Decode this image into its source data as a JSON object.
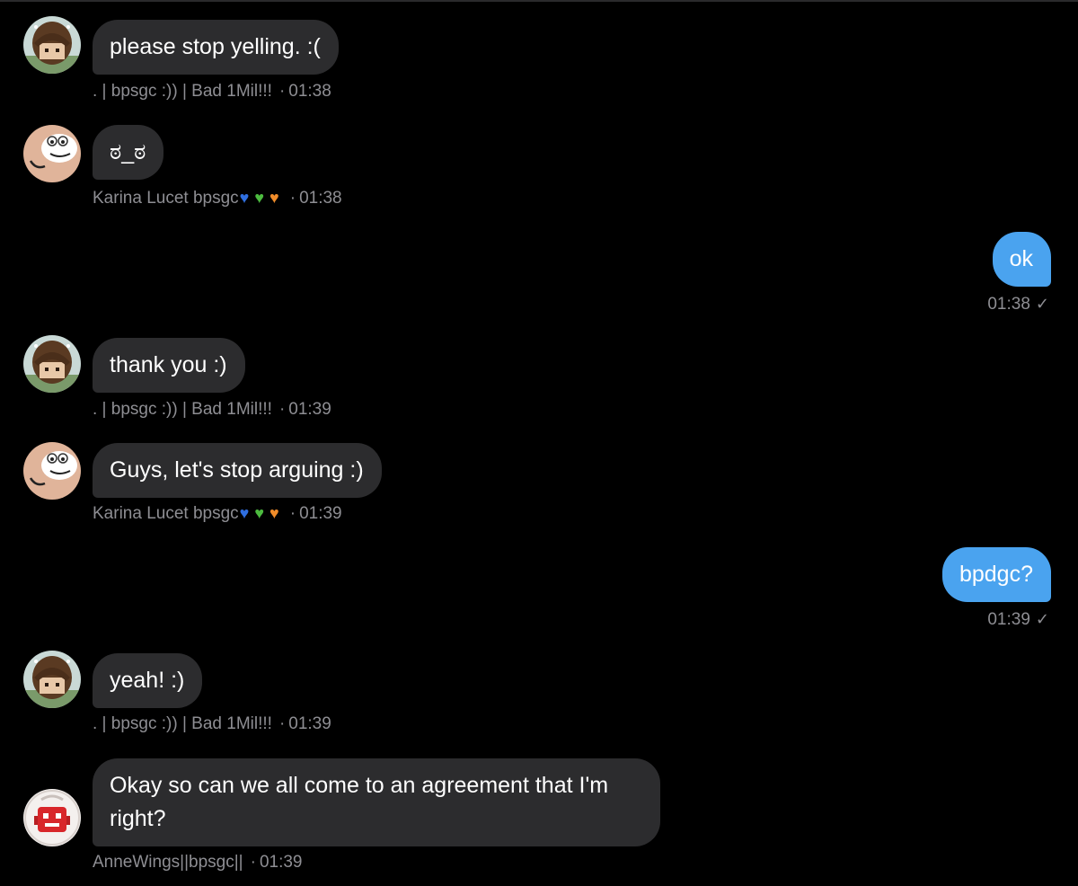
{
  "colors": {
    "background": "#000000",
    "incoming_bubble": "#2c2c2e",
    "outgoing_bubble": "#4aa3ef",
    "meta_text": "#8e8e93",
    "heart_blue": "#2f6fe0",
    "heart_green": "#4cbb3f",
    "heart_orange": "#f08c2a"
  },
  "messages": [
    {
      "text": "please stop yelling. :(",
      "sender": ". | bpsgc :)) | Bad 1Mil!!!",
      "time": "01:38",
      "avatar_icon": "brown-hair-character-icon"
    },
    {
      "text": "ಠ_ಠ",
      "sender": "Karina Lucet bpsgc",
      "time": "01:38",
      "avatar_icon": "cartoon-smiling-face-icon",
      "hearts": [
        "blue-heart-icon",
        "green-heart-icon",
        "orange-heart-icon"
      ]
    },
    {
      "text": "ok",
      "time": "01:38",
      "status_icon": "sent-check-icon"
    },
    {
      "text": "thank you :)",
      "sender": ". | bpsgc :)) | Bad 1Mil!!!",
      "time": "01:39",
      "avatar_icon": "brown-hair-character-icon"
    },
    {
      "text": "Guys, let's stop arguing :)",
      "sender": "Karina Lucet bpsgc",
      "time": "01:39",
      "avatar_icon": "cartoon-smiling-face-icon",
      "hearts": [
        "blue-heart-icon",
        "green-heart-icon",
        "orange-heart-icon"
      ]
    },
    {
      "text": "bpdgc?",
      "time": "01:39",
      "status_icon": "sent-check-icon"
    },
    {
      "text": "yeah! :)",
      "sender": ". | bpsgc :)) | Bad 1Mil!!!",
      "time": "01:39",
      "avatar_icon": "brown-hair-character-icon"
    },
    {
      "text": "Okay so can we all come to an agreement that I'm right?",
      "sender": "AnneWings||bpsgc||",
      "time": "01:39",
      "avatar_icon": "red-robot-character-icon"
    }
  ],
  "separator": "·",
  "check_glyph": "✓"
}
